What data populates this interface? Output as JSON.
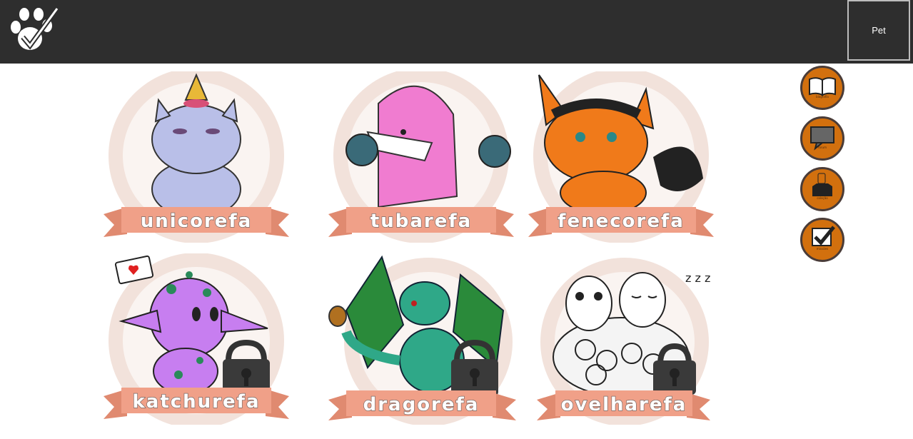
{
  "header": {
    "logo_icon": "paw-check-icon",
    "pet_button_label": "Pet"
  },
  "pets": [
    {
      "name": "unicorefa",
      "icon": "unicorn-icon",
      "locked": false,
      "color": "#b9bfe8"
    },
    {
      "name": "tubarefa",
      "icon": "shark-icon",
      "locked": false,
      "color": "#f07cd0"
    },
    {
      "name": "fenecorefa",
      "icon": "fox-icon",
      "locked": false,
      "color": "#f07a1a"
    },
    {
      "name": "katchurefa",
      "icon": "purple-creature-icon",
      "locked": true,
      "color": "#c77ef0"
    },
    {
      "name": "dragorefa",
      "icon": "dragon-icon",
      "locked": true,
      "color": "#2fa888"
    },
    {
      "name": "ovelharefa",
      "icon": "sheep-icon",
      "locked": true,
      "color": "#f4f4f4"
    }
  ],
  "side_menu": [
    {
      "label": "biografia",
      "icon": "book-icon"
    },
    {
      "label": "forum",
      "icon": "chat-bubble-icon"
    },
    {
      "label": "coleção",
      "icon": "collection-icon"
    },
    {
      "label": "missões",
      "icon": "checkbox-icon"
    }
  ],
  "colors": {
    "topbar": "#2e2e2e",
    "ribbon": "#f0a088",
    "ribbon_dark": "#e08a70",
    "circle_outer": "#f2e2db",
    "circle_inner": "#faf4f1",
    "side_button": "#d2700e"
  }
}
